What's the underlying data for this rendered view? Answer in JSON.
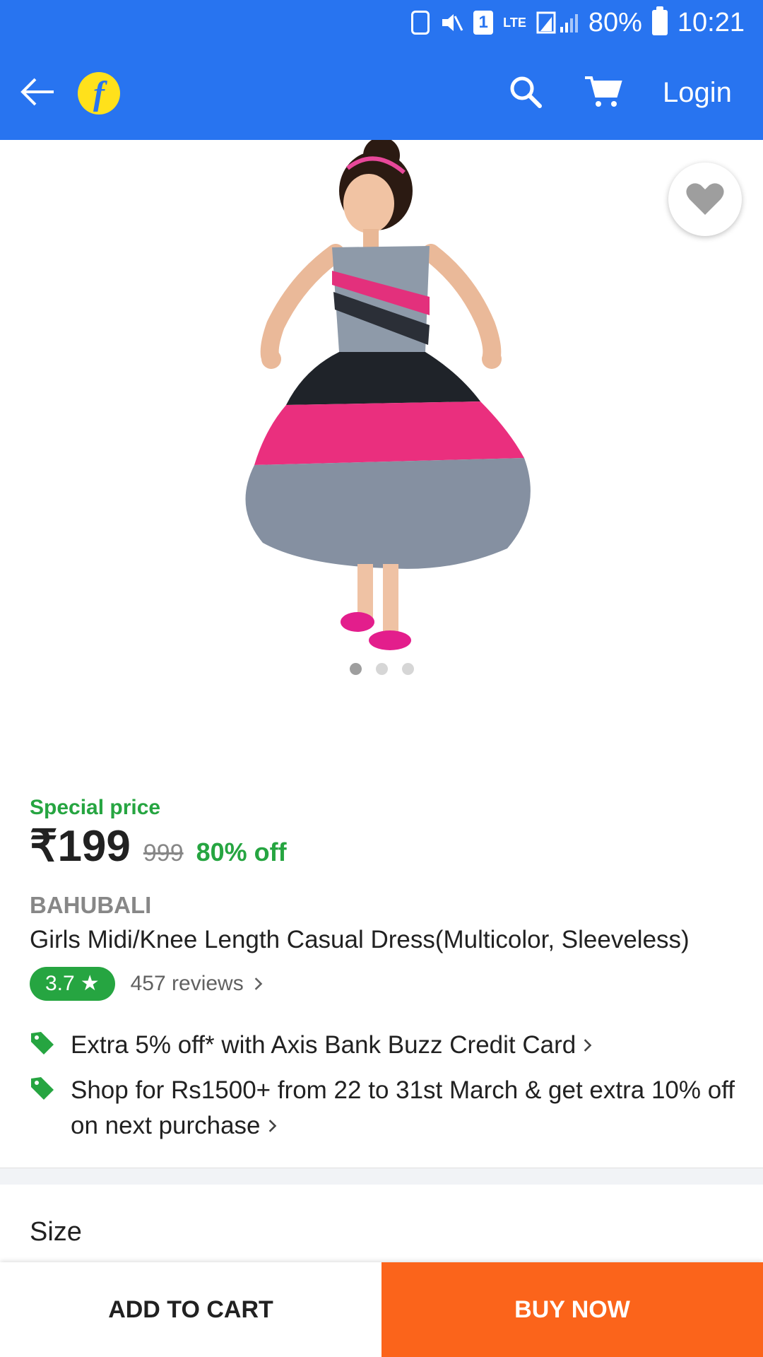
{
  "status_bar": {
    "battery_percent": "80%",
    "time": "10:21",
    "sim_slot": "1",
    "network": "LTE"
  },
  "header": {
    "login_label": "Login",
    "brand_color": "#2874f0"
  },
  "product": {
    "image_alt_icon": "product-photo-girls-dress",
    "carousel": {
      "count": 3,
      "active_index": 0
    },
    "special_price_label": "Special price",
    "price": "₹199",
    "mrp": "999",
    "discount": "80% off",
    "brand": "BAHUBALI",
    "title": "Girls Midi/Knee Length Casual Dress(Multicolor, Sleeveless)",
    "rating": "3.7",
    "rating_star": "★",
    "reviews": "457 reviews"
  },
  "offers": [
    {
      "text": "Extra 5% off* with Axis Bank Buzz Credit Card"
    },
    {
      "text": "Shop for Rs1500+ from 22 to 31st March & get extra 10% off on next purchase"
    }
  ],
  "size_section": {
    "label": "Size"
  },
  "bottom_bar": {
    "add_to_cart": "ADD TO CART",
    "buy_now": "BUY NOW",
    "buy_now_color": "#fb641b"
  }
}
